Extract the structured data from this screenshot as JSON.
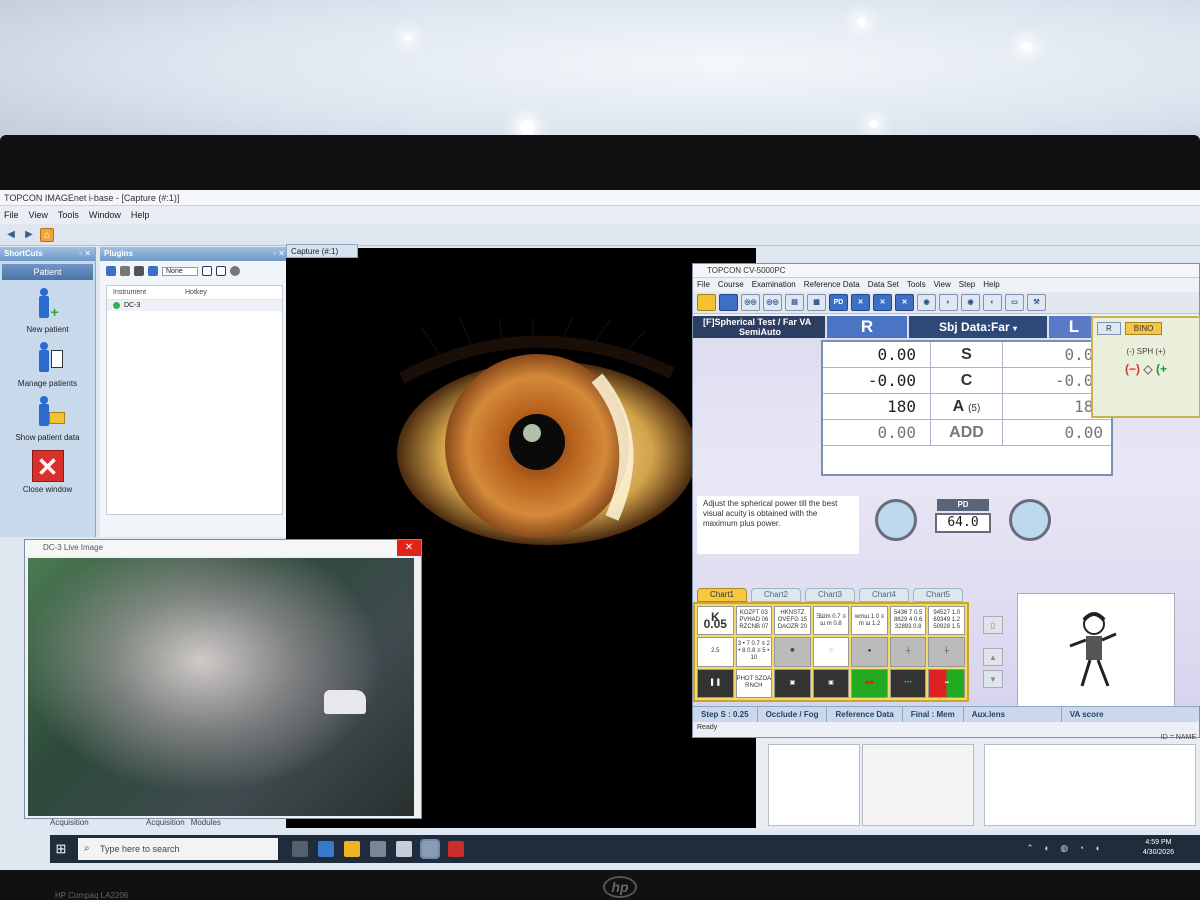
{
  "app": {
    "title": "TOPCON IMAGEnet i-base - [Capture (#:1)]",
    "menu": [
      "File",
      "View",
      "Tools",
      "Window",
      "Help"
    ]
  },
  "shortcuts": {
    "header": "ShortCuts",
    "tab": "Patient",
    "items": [
      {
        "label": "New patient",
        "icon": "new-patient-icon"
      },
      {
        "label": "Manage patients",
        "icon": "manage-patients-icon"
      },
      {
        "label": "Show patient data",
        "icon": "show-patient-data-icon"
      },
      {
        "label": "Close window",
        "icon": "close-window-icon"
      }
    ]
  },
  "plugins": {
    "header": "Plugins",
    "none_field": "None",
    "columns": [
      "Instrument",
      "Hotkey"
    ],
    "rows": [
      {
        "instrument": "DC-3",
        "status": "connected"
      }
    ]
  },
  "capture": {
    "tab": "Capture (#:1)"
  },
  "live": {
    "title": "DC-3 Live Image"
  },
  "bottom_tabs": [
    "Acquisition",
    "Acquisition",
    "Modules"
  ],
  "cv": {
    "title": "TOPCON CV-5000PC",
    "menu": [
      "File",
      "Course",
      "Examination",
      "Reference Data",
      "Data Set",
      "Tools",
      "View",
      "Step",
      "Help"
    ],
    "test_line1": "[F]Spherical Test / Far VA",
    "test_line2": "SemiAuto",
    "r_label": "R",
    "sbj_label": "Sbj Data:Far",
    "l_label": "L",
    "rows": [
      {
        "r": "0.00",
        "label": "S",
        "sub": "",
        "l": "0.00"
      },
      {
        "r": "-0.00",
        "label": "C",
        "sub": "",
        "l": "-0.00"
      },
      {
        "r": "180",
        "label": "A",
        "sub": "(5)",
        "l": "180"
      },
      {
        "r": "0.00",
        "label": "ADD",
        "sub": "",
        "l": "0.00"
      }
    ],
    "side_r": "R",
    "side_bino": "BINO",
    "sph_label": "(-) SPH (+)",
    "hint": "Adjust the spherical power till the best visual acuity is obtained with the maximum plus power.",
    "pd_label": "PD",
    "pd_value": "64.0",
    "chart_tabs": [
      "Chart1",
      "Chart2",
      "Chart3",
      "Chart4",
      "Chart5"
    ],
    "charts_row1": [
      "K 0.05",
      "KOZFT 03 PVHAD 06 RZCNB 07",
      "HKNSTZ OVEFG 15 DAOZR 20",
      "ƎШm 0.7 ≡ ш m 0.8",
      "wmш 1.0 ≡ m ш 1.2",
      "5436 7 0.5 8829 4 0.6 32893 0.8",
      "94527 1.0 69349 1.2 50928 1.5"
    ],
    "charts_row2": [
      "2.5",
      "3 • 7 0.7 ≡ 2 • 8 0.8 ≡ 5 • 10",
      "",
      "",
      "",
      "",
      ""
    ],
    "charts_row3": [
      "",
      "PHOT SZOA RNCH",
      "",
      "",
      "",
      "",
      ""
    ],
    "status": [
      "Step S : 0.25",
      "Occlude / Fog",
      "Reference Data",
      "Final : Mem",
      "Aux.lens",
      "VA score"
    ],
    "ready": "Ready"
  },
  "lower_right": {
    "id_label": "ID",
    "name_label": "NAME"
  },
  "taskbar": {
    "search_placeholder": "Type here to search",
    "time": "4:59 PM",
    "date": "4/30/2026"
  },
  "bezel": {
    "brand": "hp",
    "model": "HP Compaq LA2206"
  }
}
